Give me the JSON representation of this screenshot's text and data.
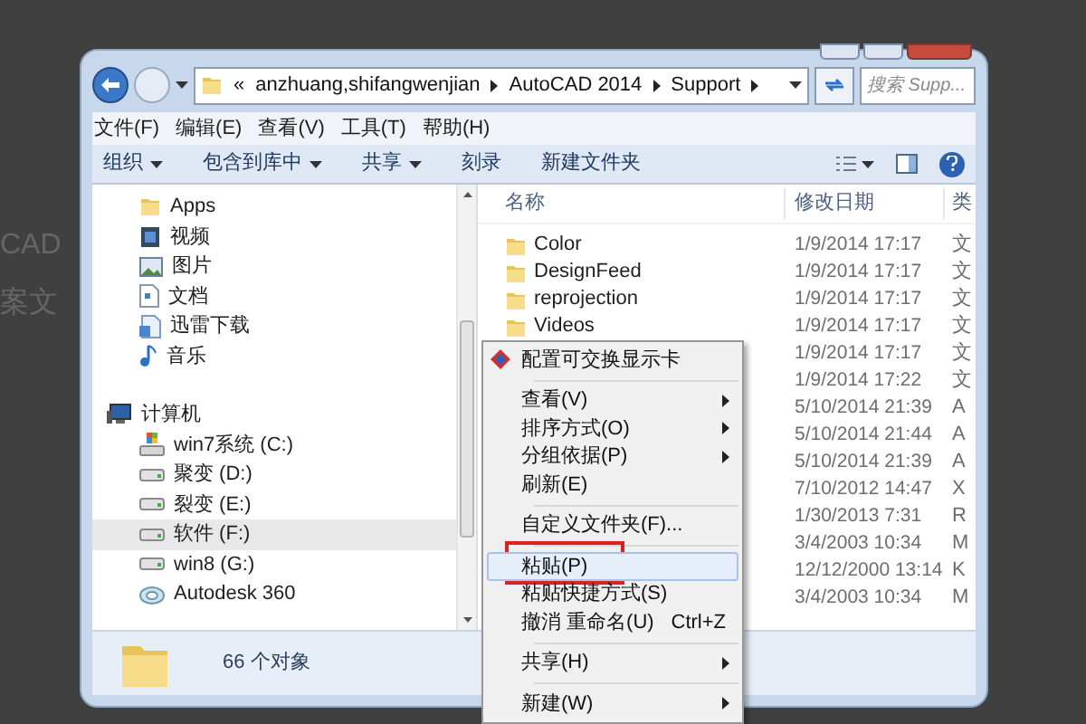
{
  "desktop": {
    "background_texts": [
      "CAD",
      "案文"
    ]
  },
  "window": {
    "address": {
      "overflow": "«",
      "segments": [
        "anzhuang,shifangwenjian",
        "AutoCAD 2014",
        "Support"
      ]
    },
    "search": {
      "placeholder": "搜索 Supp..."
    },
    "menu_bar": [
      "文件(F)",
      "编辑(E)",
      "查看(V)",
      "工具(T)",
      "帮助(H)"
    ],
    "toolbar": [
      {
        "label": "组织",
        "dropdown": true
      },
      {
        "label": "包含到库中",
        "dropdown": true
      },
      {
        "label": "共享",
        "dropdown": true
      },
      {
        "label": "刻录",
        "dropdown": false
      },
      {
        "label": "新建文件夹",
        "dropdown": false
      }
    ],
    "nav_pane": {
      "favorites": [
        {
          "label": "Apps",
          "kind": "folder",
          "selected": false
        },
        {
          "label": "视频",
          "kind": "video",
          "selected": false
        },
        {
          "label": "图片",
          "kind": "picture",
          "selected": false
        },
        {
          "label": "文档",
          "kind": "document",
          "selected": false
        },
        {
          "label": "迅雷下载",
          "kind": "download",
          "selected": false
        },
        {
          "label": "音乐",
          "kind": "music",
          "selected": false
        }
      ],
      "computer": [
        {
          "label": "计算机",
          "kind": "computer",
          "selected": false
        },
        {
          "label": "win7系统 (C:)",
          "kind": "system",
          "selected": false
        },
        {
          "label": "聚变 (D:)",
          "kind": "drive",
          "selected": false
        },
        {
          "label": "裂变 (E:)",
          "kind": "drive",
          "selected": false
        },
        {
          "label": "软件 (F:)",
          "kind": "drive",
          "selected": true
        },
        {
          "label": "win8 (G:)",
          "kind": "drive",
          "selected": false
        },
        {
          "label": "Autodesk 360",
          "kind": "cloud",
          "selected": false
        }
      ]
    },
    "file_list": {
      "columns": [
        "名称",
        "修改日期",
        "类"
      ],
      "rows": [
        {
          "name": "Color",
          "date": "1/9/2014 17:17",
          "column_3": "文"
        },
        {
          "name": "DesignFeed",
          "date": "1/9/2014 17:17",
          "column_3": "文"
        },
        {
          "name": "reprojection",
          "date": "1/9/2014 17:17",
          "column_3": "文"
        },
        {
          "name": "Videos",
          "date": "1/9/2014 17:17",
          "column_3": "文"
        },
        {
          "date": "1/9/2014 17:17",
          "column_3": "文"
        },
        {
          "date": "1/9/2014 17:22",
          "column_3": "文"
        },
        {
          "date": "5/10/2014 21:39",
          "column_3": "A"
        },
        {
          "date": "5/10/2014 21:44",
          "column_3": "A"
        },
        {
          "date": "5/10/2014 21:39",
          "column_3": "A"
        },
        {
          "date": "7/10/2012 14:47",
          "column_3": "X"
        },
        {
          "date": "1/30/2013 7:31",
          "column_3": "R"
        },
        {
          "date": "3/4/2003 10:34",
          "column_3": "M"
        },
        {
          "date": "12/12/2000 13:14",
          "column_3": "K"
        },
        {
          "date": "3/4/2003 10:34",
          "column_3": "M"
        }
      ]
    },
    "status_bar": {
      "count": "66 个对象"
    }
  },
  "context_menu": {
    "items": [
      {
        "kind": "item",
        "label": "配置可交换显示卡",
        "icon": true,
        "submenu": false,
        "selected": false,
        "marked": false
      },
      {
        "kind": "separator"
      },
      {
        "kind": "item",
        "label": "查看(V)",
        "submenu": true,
        "selected": false,
        "marked": false
      },
      {
        "kind": "item",
        "label": "排序方式(O)",
        "submenu": true,
        "selected": false,
        "marked": false
      },
      {
        "kind": "item",
        "label": "分组依据(P)",
        "submenu": true,
        "selected": false,
        "marked": false
      },
      {
        "kind": "item",
        "label": "刷新(E)",
        "submenu": false,
        "selected": false,
        "marked": false
      },
      {
        "kind": "separator"
      },
      {
        "kind": "item",
        "label": "自定义文件夹(F)...",
        "submenu": false,
        "selected": false,
        "marked": false
      },
      {
        "kind": "separator"
      },
      {
        "kind": "item",
        "label": "粘贴(P)",
        "submenu": false,
        "selected": true,
        "marked": true
      },
      {
        "kind": "item",
        "label": "粘贴快捷方式(S)",
        "submenu": false,
        "selected": false,
        "marked": false
      },
      {
        "kind": "item",
        "label": "撤消 重命名(U)",
        "shortcut": "Ctrl+Z",
        "submenu": false,
        "selected": false,
        "marked": false
      },
      {
        "kind": "separator"
      },
      {
        "kind": "item",
        "label": "共享(H)",
        "submenu": true,
        "selected": false,
        "marked": false
      },
      {
        "kind": "separator"
      },
      {
        "kind": "item",
        "label": "新建(W)",
        "submenu": true,
        "selected": false,
        "marked": false
      }
    ]
  }
}
